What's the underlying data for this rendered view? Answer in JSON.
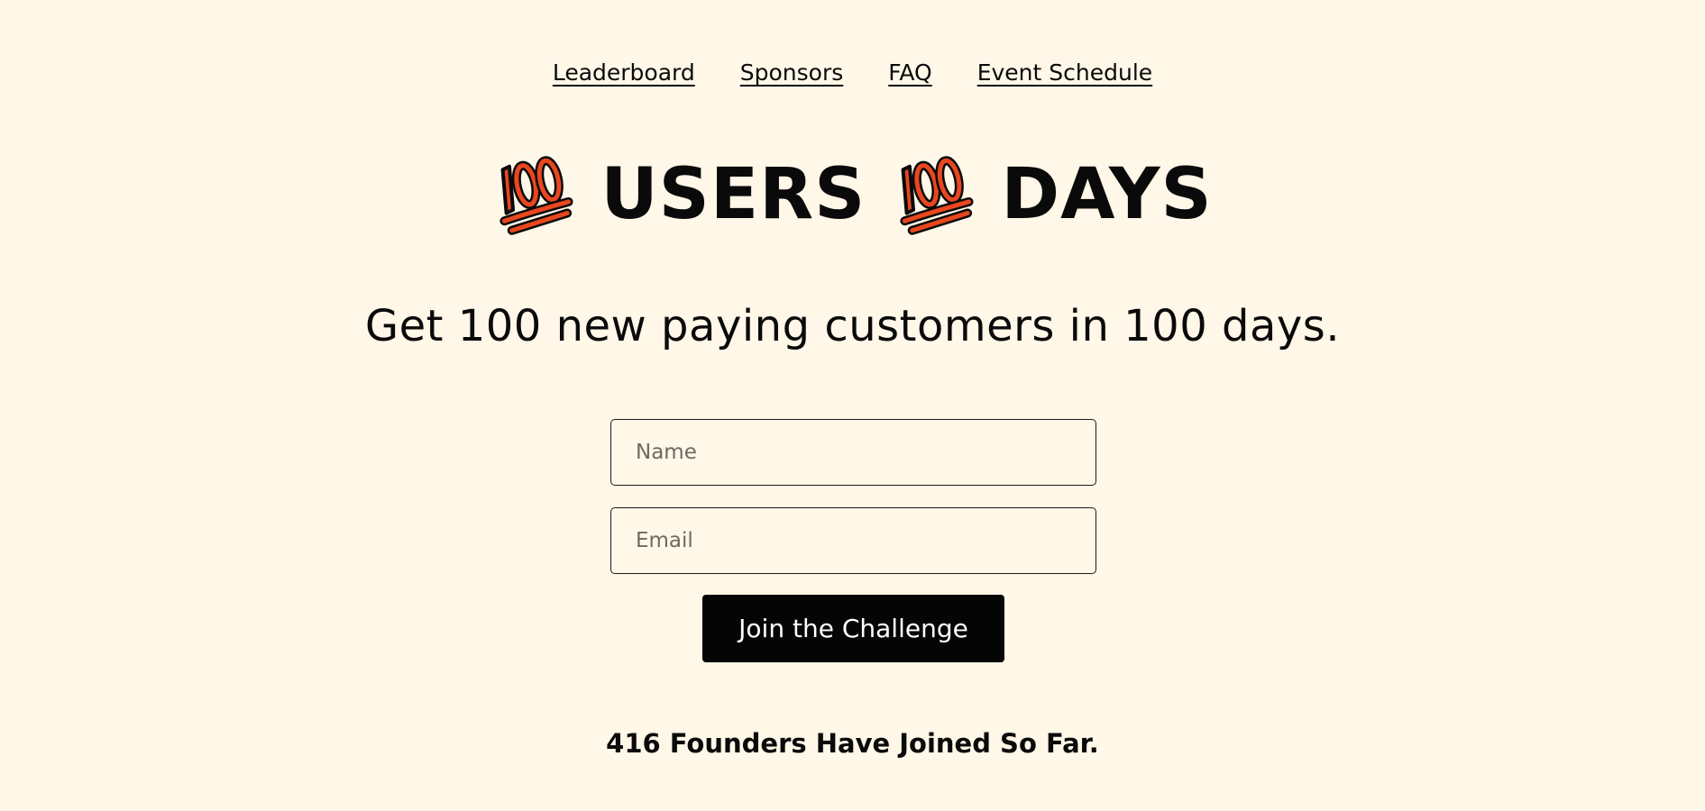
{
  "nav": {
    "items": [
      {
        "label": "Leaderboard"
      },
      {
        "label": "Sponsors"
      },
      {
        "label": "FAQ"
      },
      {
        "label": "Event Schedule"
      }
    ]
  },
  "hero": {
    "title_word_1": "USERS",
    "title_word_2": "DAYS",
    "icon": "hundred-points-emoji",
    "icon_color": "#e8471f",
    "subtitle": "Get 100 new paying customers in 100 days."
  },
  "form": {
    "name_placeholder": "Name",
    "name_value": "",
    "email_placeholder": "Email",
    "email_value": "",
    "submit_label": "Join the Challenge"
  },
  "stats": {
    "founders_joined_text": "416 Founders Have Joined So Far."
  },
  "colors": {
    "background": "#fff7e8",
    "text": "#0a0a0a",
    "button": "#050505",
    "accent": "#e8471f"
  }
}
